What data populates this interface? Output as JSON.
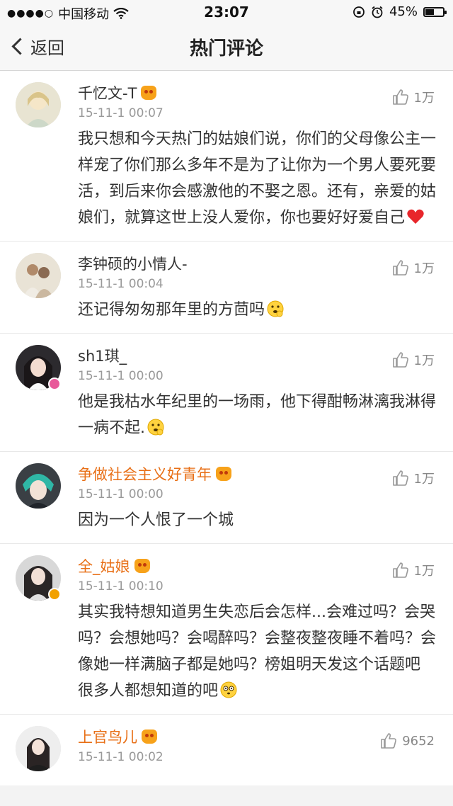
{
  "status_bar": {
    "signal_dots": "●●●●○",
    "carrier": "中国移动",
    "time": "23:07",
    "battery": "45%",
    "battery_level": 0.45
  },
  "nav": {
    "back_label": "返回",
    "title": "热门评论"
  },
  "comments": [
    {
      "username": "千忆文-T",
      "timestamp": "15-11-1 00:07",
      "likes": "1万",
      "content": "我只想和今天热门的姑娘们说，你们的父母像公主一样宠了你们那么多年不是为了让你为一个男人要死要活，到后来你会感激他的不娶之恩。还有，亲爱的姑娘们，就算这世上没人爱你，你也要好好爱自己"
    },
    {
      "username": "李钟硕的小情人-",
      "timestamp": "15-11-1 00:04",
      "likes": "1万",
      "content": "还记得匆匆那年里的方茴吗"
    },
    {
      "username": "sh1琪_",
      "timestamp": "15-11-1 00:00",
      "likes": "1万",
      "content": "他是我枯水年纪里的一场雨，他下得酣畅淋漓我淋得一病不起."
    },
    {
      "username": "争做社会主义好青年",
      "timestamp": "15-11-1 00:00",
      "likes": "1万",
      "content": "因为一个人恨了一个城"
    },
    {
      "username": "全_姑娘",
      "timestamp": "15-11-1 00:10",
      "likes": "1万",
      "content": "其实我特想知道男生失恋后会怎样...会难过吗？会哭吗？会想她吗？会喝醉吗？会整夜整夜睡不着吗？会像她一样满脑子都是她吗？榜姐明天发这个话题吧 很多人都想知道的吧"
    },
    {
      "username": "上官鸟儿",
      "timestamp": "15-11-1 00:02",
      "likes": "9652",
      "content": ""
    }
  ],
  "colors": {
    "vip_name": "#e86f16",
    "normal_name": "#333333",
    "meta": "#999999"
  }
}
